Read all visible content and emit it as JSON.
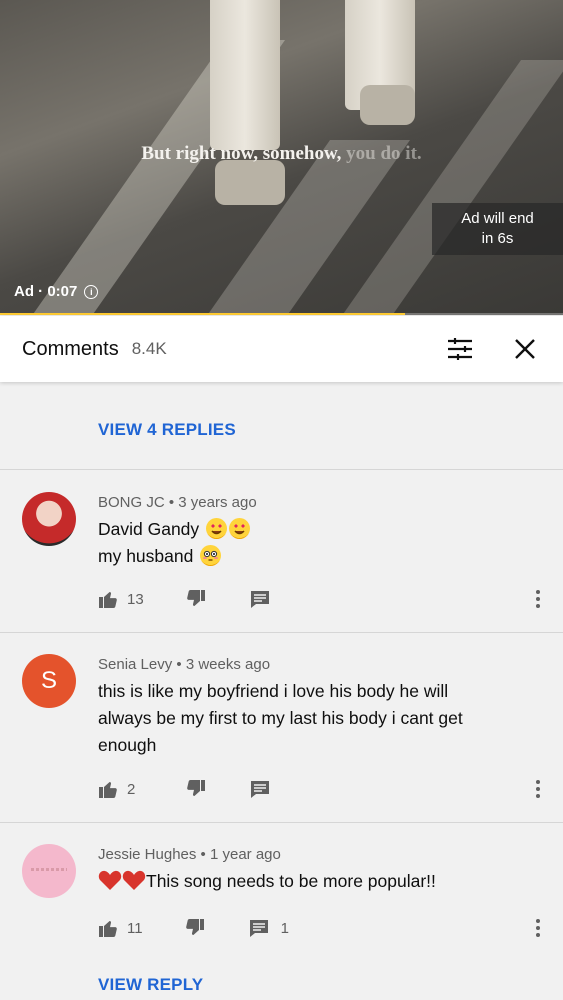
{
  "video": {
    "subtitle_main": "But right now, somehow,",
    "subtitle_fade": "you do it.",
    "ad_end_line1": "Ad will end",
    "ad_end_line2": "in 6s",
    "ad_label": "Ad · 0:07",
    "info_glyph": "i",
    "progress_fraction": 0.72,
    "progress_color": "#ffcc33"
  },
  "header": {
    "title": "Comments",
    "count": "8.4K"
  },
  "view_4_replies": "VIEW 4 REPLIES",
  "comments": [
    {
      "author": "BONG JC",
      "time": "3 years ago",
      "line1": "David Gandy",
      "line2": "my husband",
      "likes": "13",
      "replies": ""
    },
    {
      "author": "Senia Levy",
      "time": "3 weeks ago",
      "avatar_letter": "S",
      "avatar_color": "#e4532c",
      "line1": "this is like my boyfriend i love his body he will",
      "line2": "always be my first to my last his body i cant get",
      "line3": "enough",
      "likes": "2",
      "replies": ""
    },
    {
      "author": "Jessie Hughes",
      "time": "1 year ago",
      "avatar_color": "#f4b8cc",
      "line1": "This song needs to be more popular!!",
      "likes": "11",
      "replies": "1"
    }
  ],
  "view_reply": "VIEW REPLY",
  "colors": {
    "link_blue": "#2065d4",
    "heart_red": "#d8342c"
  },
  "icons": [
    "filter-icon",
    "close-icon",
    "like-icon",
    "dislike-icon",
    "reply-icon",
    "more-vert-icon",
    "info-icon",
    "heart-eyes-emoji",
    "flushed-emoji",
    "heart-emoji"
  ]
}
